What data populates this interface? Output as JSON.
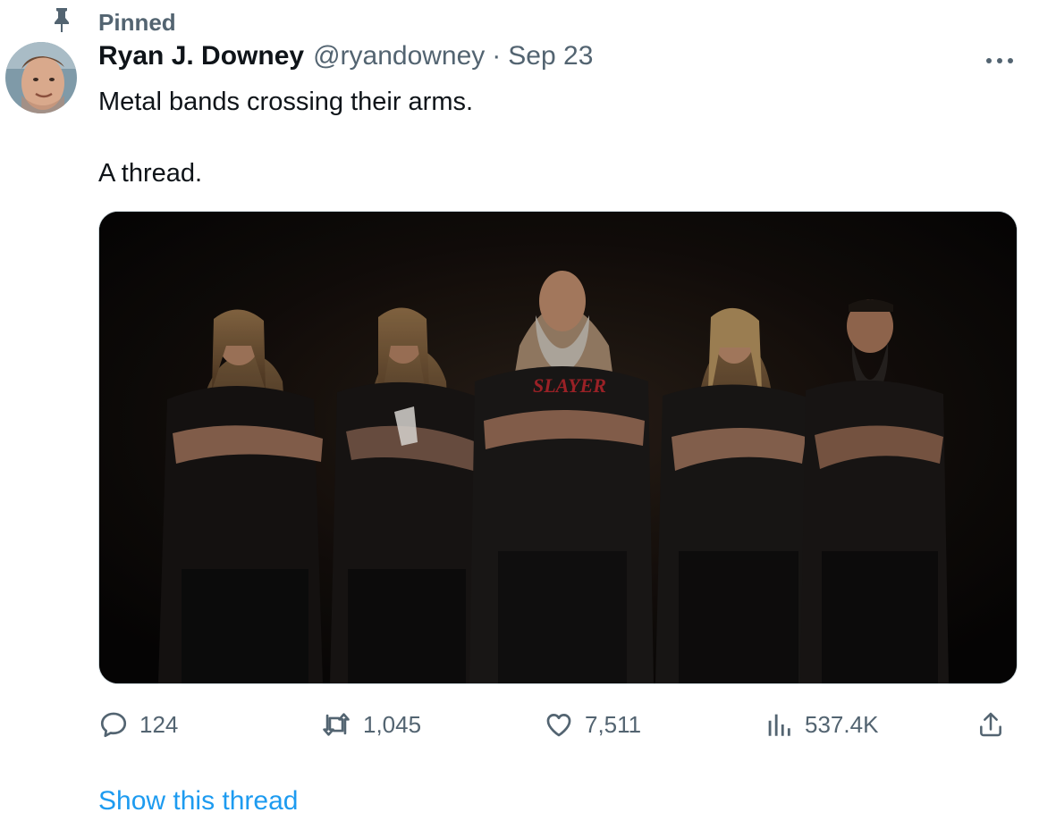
{
  "pinned": {
    "label": "Pinned"
  },
  "tweet": {
    "author_name": "Ryan J. Downey",
    "handle": "@ryandowney",
    "separator": "·",
    "date": "Sep 23",
    "text_line1": "Metal bands crossing their arms.",
    "text_line2": "A thread.",
    "image_alt": "Band photo: five men in black t-shirts standing with crossed arms against a dark background",
    "shirt_text": "SLAYER"
  },
  "actions": {
    "replies": "124",
    "retweets": "1,045",
    "likes": "7,511",
    "views": "537.4K"
  },
  "show_thread": "Show this thread",
  "colors": {
    "secondary_text": "#536471",
    "link": "#1d9bf0",
    "primary_text": "#0f1419"
  },
  "icons": [
    "pin-icon",
    "more-icon",
    "reply-icon",
    "retweet-icon",
    "like-icon",
    "views-icon",
    "share-icon"
  ]
}
